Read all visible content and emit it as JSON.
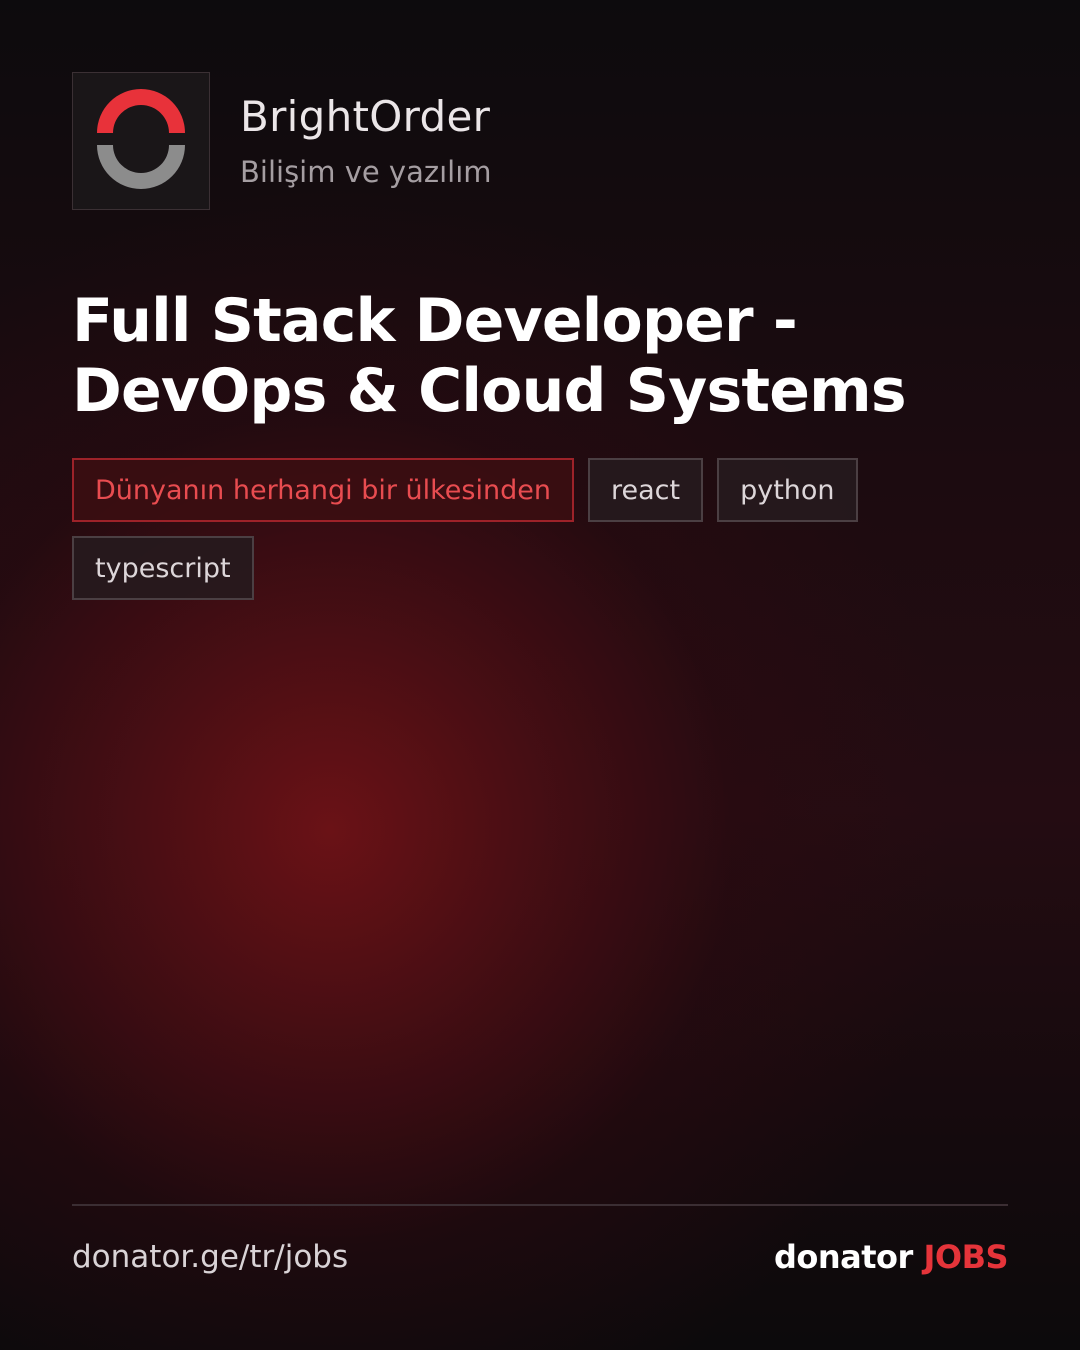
{
  "company": {
    "name": "BrightOrder",
    "category": "Bilişim ve yazılım",
    "logo_icon": "ring-logo-icon",
    "logo_colors": {
      "top": "#e8323a",
      "bottom": "#8c8c8c"
    }
  },
  "job": {
    "title": "Full Stack Developer - DevOps & Cloud Systems"
  },
  "tags": {
    "location": "Dünyanın herhangi bir ülkesinden",
    "skills": [
      "react",
      "python",
      "typescript"
    ]
  },
  "footer": {
    "url": "donator.ge/tr/jobs",
    "brand_word": "donator",
    "brand_accent": "JOBS"
  },
  "colors": {
    "accent": "#e5343a",
    "background": "#0e0a0c"
  }
}
